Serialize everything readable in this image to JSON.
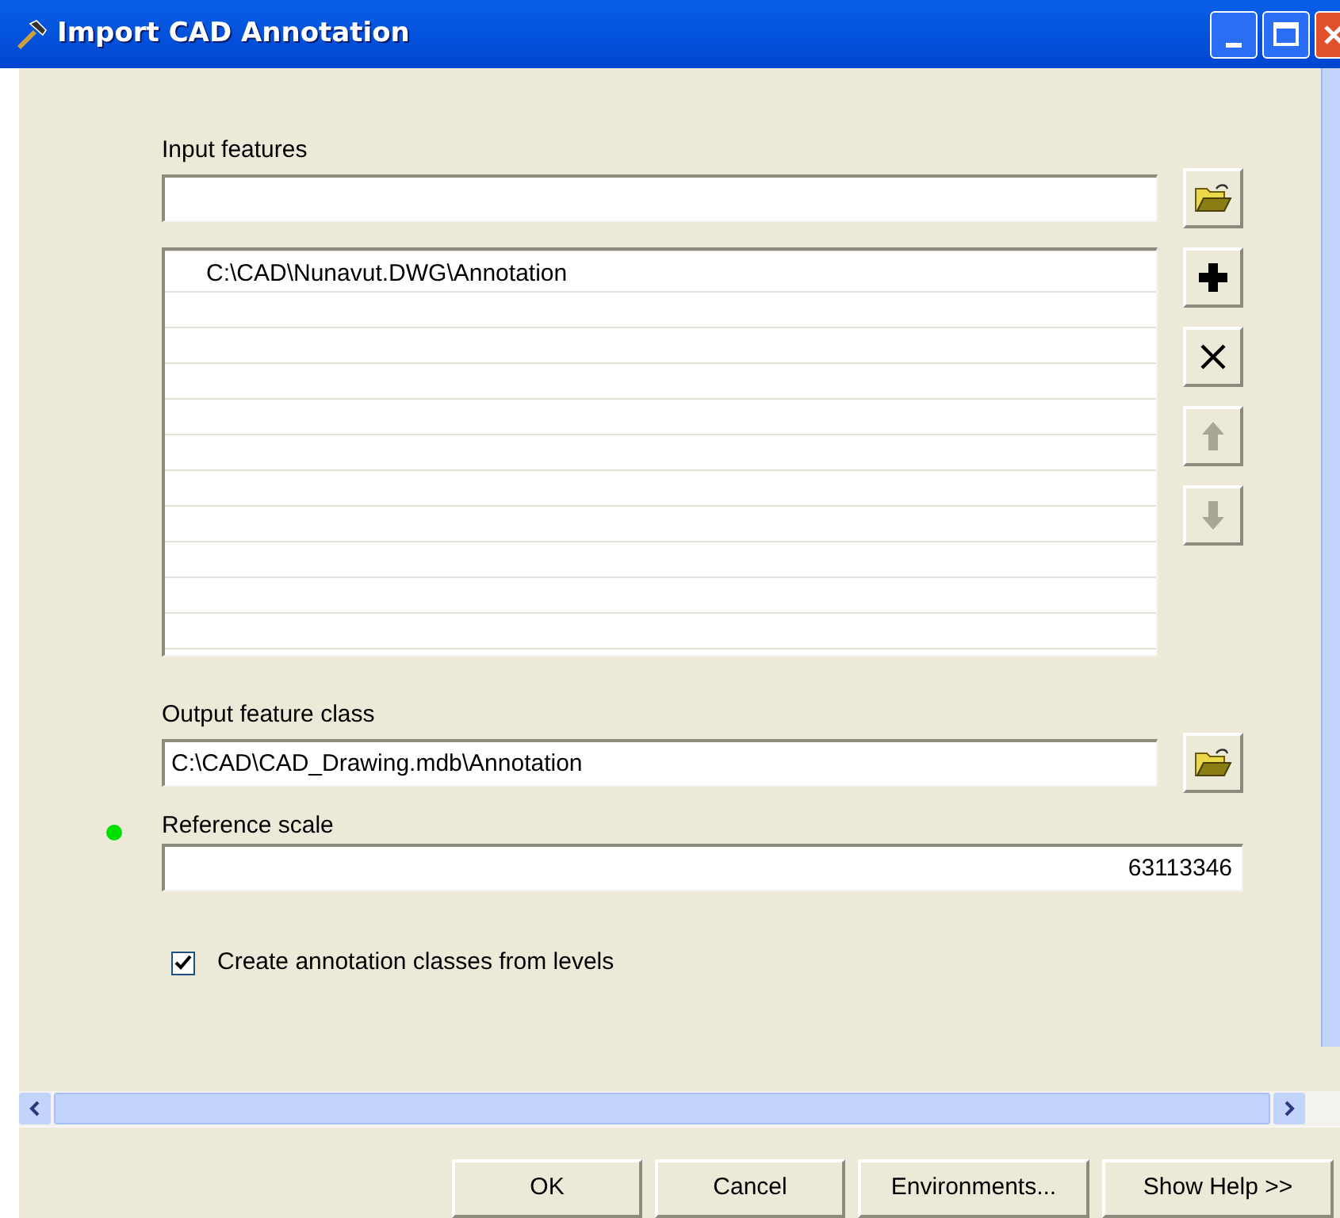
{
  "window": {
    "title": "Import CAD Annotation"
  },
  "input_features": {
    "label": "Input features"
  },
  "input_list": {
    "rows": [
      "C:\\CAD\\Nunavut.DWG\\Annotation"
    ]
  },
  "list_buttons": [
    {
      "kind": "add",
      "disabled": false
    },
    {
      "kind": "remove",
      "disabled": false
    },
    {
      "kind": "up",
      "disabled": true
    },
    {
      "kind": "down",
      "disabled": true
    }
  ],
  "output_feature_class": {
    "label": "Output feature class",
    "value": "C:\\CAD\\CAD_Drawing.mdb\\Annotation"
  },
  "reference_scale": {
    "label": "Reference scale",
    "value": "63113346",
    "optional": true
  },
  "create_classes": {
    "label": "Create annotation classes from levels",
    "checked": true
  },
  "buttons": [
    "OK",
    "Cancel",
    "Environments...",
    "Show Help >>"
  ]
}
